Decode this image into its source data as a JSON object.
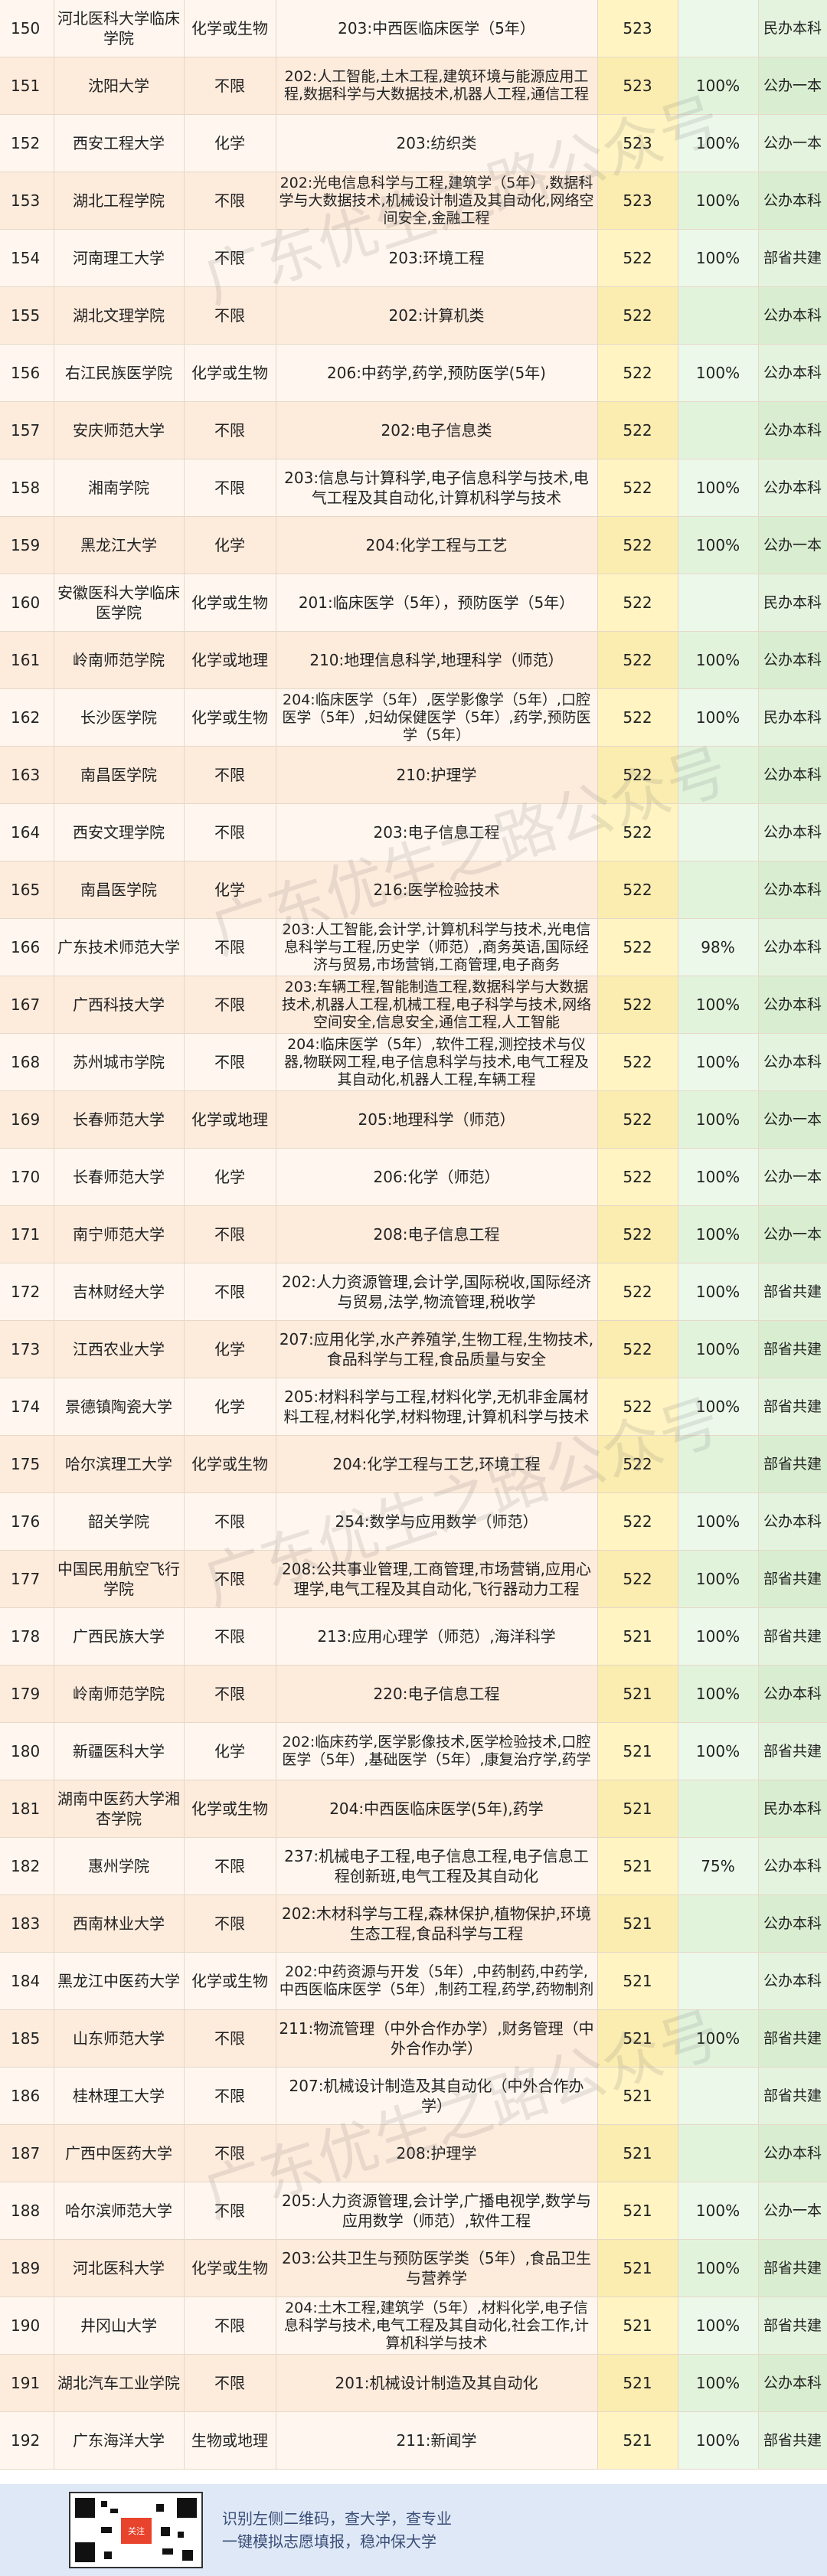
{
  "rows": [
    {
      "no": "150",
      "school": "河北医科大学临床学院",
      "subject": "化学或生物",
      "major": "203:中西医临床医学（5年）",
      "score": "523",
      "rate": "",
      "type": "民办本科"
    },
    {
      "no": "151",
      "school": "沈阳大学",
      "subject": "不限",
      "major": "202:人工智能,土木工程,建筑环境与能源应用工程,数据科学与大数据技术,机器人工程,通信工程",
      "score": "523",
      "rate": "100%",
      "type": "公办一本"
    },
    {
      "no": "152",
      "school": "西安工程大学",
      "subject": "化学",
      "major": "203:纺织类",
      "score": "523",
      "rate": "100%",
      "type": "公办一本"
    },
    {
      "no": "153",
      "school": "湖北工程学院",
      "subject": "不限",
      "major": "202:光电信息科学与工程,建筑学（5年）,数据科学与大数据技术,机械设计制造及其自动化,网络空间安全,金融工程",
      "score": "523",
      "rate": "100%",
      "type": "公办本科"
    },
    {
      "no": "154",
      "school": "河南理工大学",
      "subject": "不限",
      "major": "203:环境工程",
      "score": "522",
      "rate": "100%",
      "type": "部省共建"
    },
    {
      "no": "155",
      "school": "湖北文理学院",
      "subject": "不限",
      "major": "202:计算机类",
      "score": "522",
      "rate": "",
      "type": "公办本科"
    },
    {
      "no": "156",
      "school": "右江民族医学院",
      "subject": "化学或生物",
      "major": "206:中药学,药学,预防医学(5年)",
      "score": "522",
      "rate": "100%",
      "type": "公办本科"
    },
    {
      "no": "157",
      "school": "安庆师范大学",
      "subject": "不限",
      "major": "202:电子信息类",
      "score": "522",
      "rate": "",
      "type": "公办本科"
    },
    {
      "no": "158",
      "school": "湘南学院",
      "subject": "不限",
      "major": "203:信息与计算科学,电子信息科学与技术,电气工程及其自动化,计算机科学与技术",
      "score": "522",
      "rate": "100%",
      "type": "公办本科"
    },
    {
      "no": "159",
      "school": "黑龙江大学",
      "subject": "化学",
      "major": "204:化学工程与工艺",
      "score": "522",
      "rate": "100%",
      "type": "公办一本"
    },
    {
      "no": "160",
      "school": "安徽医科大学临床医学院",
      "subject": "化学或生物",
      "major": "201:临床医学（5年），预防医学（5年）",
      "score": "522",
      "rate": "",
      "type": "民办本科"
    },
    {
      "no": "161",
      "school": "岭南师范学院",
      "subject": "化学或地理",
      "major": "210:地理信息科学,地理科学（师范）",
      "score": "522",
      "rate": "100%",
      "type": "公办本科"
    },
    {
      "no": "162",
      "school": "长沙医学院",
      "subject": "化学或生物",
      "major": "204:临床医学（5年）,医学影像学（5年）,口腔医学（5年）,妇幼保健医学（5年）,药学,预防医学（5年）",
      "score": "522",
      "rate": "100%",
      "type": "民办本科"
    },
    {
      "no": "163",
      "school": "南昌医学院",
      "subject": "不限",
      "major": "210:护理学",
      "score": "522",
      "rate": "",
      "type": "公办本科"
    },
    {
      "no": "164",
      "school": "西安文理学院",
      "subject": "不限",
      "major": "203:电子信息工程",
      "score": "522",
      "rate": "",
      "type": "公办本科"
    },
    {
      "no": "165",
      "school": "南昌医学院",
      "subject": "化学",
      "major": "216:医学检验技术",
      "score": "522",
      "rate": "",
      "type": "公办本科"
    },
    {
      "no": "166",
      "school": "广东技术师范大学",
      "subject": "不限",
      "major": "203:人工智能,会计学,计算机科学与技术,光电信息科学与工程,历史学（师范）,商务英语,国际经济与贸易,市场营销,工商管理,电子商务",
      "score": "522",
      "rate": "98%",
      "type": "公办本科"
    },
    {
      "no": "167",
      "school": "广西科技大学",
      "subject": "不限",
      "major": "203:车辆工程,智能制造工程,数据科学与大数据技术,机器人工程,机械工程,电子科学与技术,网络空间安全,信息安全,通信工程,人工智能",
      "score": "522",
      "rate": "100%",
      "type": "公办本科"
    },
    {
      "no": "168",
      "school": "苏州城市学院",
      "subject": "不限",
      "major": "204:临床医学（5年）,软件工程,测控技术与仪器,物联网工程,电子信息科学与技术,电气工程及其自动化,机器人工程,车辆工程",
      "score": "522",
      "rate": "100%",
      "type": "公办本科"
    },
    {
      "no": "169",
      "school": "长春师范大学",
      "subject": "化学或地理",
      "major": "205:地理科学（师范）",
      "score": "522",
      "rate": "100%",
      "type": "公办一本"
    },
    {
      "no": "170",
      "school": "长春师范大学",
      "subject": "化学",
      "major": "206:化学（师范）",
      "score": "522",
      "rate": "100%",
      "type": "公办一本"
    },
    {
      "no": "171",
      "school": "南宁师范大学",
      "subject": "不限",
      "major": "208:电子信息工程",
      "score": "522",
      "rate": "100%",
      "type": "公办一本"
    },
    {
      "no": "172",
      "school": "吉林财经大学",
      "subject": "不限",
      "major": "202:人力资源管理,会计学,国际税收,国际经济与贸易,法学,物流管理,税收学",
      "score": "522",
      "rate": "100%",
      "type": "部省共建"
    },
    {
      "no": "173",
      "school": "江西农业大学",
      "subject": "化学",
      "major": "207:应用化学,水产养殖学,生物工程,生物技术,食品科学与工程,食品质量与安全",
      "score": "522",
      "rate": "100%",
      "type": "部省共建"
    },
    {
      "no": "174",
      "school": "景德镇陶瓷大学",
      "subject": "化学",
      "major": "205:材料科学与工程,材料化学,无机非金属材料工程,材料化学,材料物理,计算机科学与技术",
      "score": "522",
      "rate": "100%",
      "type": "部省共建"
    },
    {
      "no": "175",
      "school": "哈尔滨理工大学",
      "subject": "化学或生物",
      "major": "204:化学工程与工艺,环境工程",
      "score": "522",
      "rate": "",
      "type": "部省共建"
    },
    {
      "no": "176",
      "school": "韶关学院",
      "subject": "不限",
      "major": "254:数学与应用数学（师范）",
      "score": "522",
      "rate": "100%",
      "type": "公办本科"
    },
    {
      "no": "177",
      "school": "中国民用航空飞行学院",
      "subject": "不限",
      "major": "208:公共事业管理,工商管理,市场营销,应用心理学,电气工程及其自动化,飞行器动力工程",
      "score": "522",
      "rate": "100%",
      "type": "部省共建"
    },
    {
      "no": "178",
      "school": "广西民族大学",
      "subject": "不限",
      "major": "213:应用心理学（师范）,海洋科学",
      "score": "521",
      "rate": "100%",
      "type": "部省共建"
    },
    {
      "no": "179",
      "school": "岭南师范学院",
      "subject": "不限",
      "major": "220:电子信息工程",
      "score": "521",
      "rate": "100%",
      "type": "公办本科"
    },
    {
      "no": "180",
      "school": "新疆医科大学",
      "subject": "化学",
      "major": "202:临床药学,医学影像技术,医学检验技术,口腔医学（5年）,基础医学（5年）,康复治疗学,药学",
      "score": "521",
      "rate": "100%",
      "type": "部省共建"
    },
    {
      "no": "181",
      "school": "湖南中医药大学湘杏学院",
      "subject": "化学或生物",
      "major": "204:中西医临床医学(5年),药学",
      "score": "521",
      "rate": "",
      "type": "民办本科"
    },
    {
      "no": "182",
      "school": "惠州学院",
      "subject": "不限",
      "major": "237:机械电子工程,电子信息工程,电子信息工程创新班,电气工程及其自动化",
      "score": "521",
      "rate": "75%",
      "type": "公办本科"
    },
    {
      "no": "183",
      "school": "西南林业大学",
      "subject": "不限",
      "major": "202:木材科学与工程,森林保护,植物保护,环境生态工程,食品科学与工程",
      "score": "521",
      "rate": "",
      "type": "公办本科"
    },
    {
      "no": "184",
      "school": "黑龙江中医药大学",
      "subject": "化学或生物",
      "major": "202:中药资源与开发（5年）,中药制药,中药学,中西医临床医学（5年）,制药工程,药学,药物制剂",
      "score": "521",
      "rate": "",
      "type": "公办本科"
    },
    {
      "no": "185",
      "school": "山东师范大学",
      "subject": "不限",
      "major": "211:物流管理（中外合作办学）,财务管理（中外合作办学）",
      "score": "521",
      "rate": "100%",
      "type": "部省共建"
    },
    {
      "no": "186",
      "school": "桂林理工大学",
      "subject": "不限",
      "major": "207:机械设计制造及其自动化（中外合作办学）",
      "score": "521",
      "rate": "",
      "type": "部省共建"
    },
    {
      "no": "187",
      "school": "广西中医药大学",
      "subject": "不限",
      "major": "208:护理学",
      "score": "521",
      "rate": "",
      "type": "公办本科"
    },
    {
      "no": "188",
      "school": "哈尔滨师范大学",
      "subject": "不限",
      "major": "205:人力资源管理,会计学,广播电视学,数学与应用数学（师范）,软件工程",
      "score": "521",
      "rate": "100%",
      "type": "公办一本"
    },
    {
      "no": "189",
      "school": "河北医科大学",
      "subject": "化学或生物",
      "major": "203:公共卫生与预防医学类（5年）,食品卫生与营养学",
      "score": "521",
      "rate": "100%",
      "type": "部省共建"
    },
    {
      "no": "190",
      "school": "井冈山大学",
      "subject": "不限",
      "major": "204:土木工程,建筑学（5年）,材料化学,电子信息科学与技术,电气工程及其自动化,社会工作,计算机科学与技术",
      "score": "521",
      "rate": "100%",
      "type": "部省共建"
    },
    {
      "no": "191",
      "school": "湖北汽车工业学院",
      "subject": "不限",
      "major": "201:机械设计制造及其自动化",
      "score": "521",
      "rate": "100%",
      "type": "公办本科"
    },
    {
      "no": "192",
      "school": "广东海洋大学",
      "subject": "生物或地理",
      "major": "211:新闻学",
      "score": "521",
      "rate": "100%",
      "type": "部省共建"
    }
  ],
  "watermark": "广东优生之路公众号",
  "footer": {
    "qr_badge": "关注",
    "line1": "识别左侧二维码，查大学，查专业",
    "line2": "一键模拟志愿填报，稳冲保大学"
  }
}
